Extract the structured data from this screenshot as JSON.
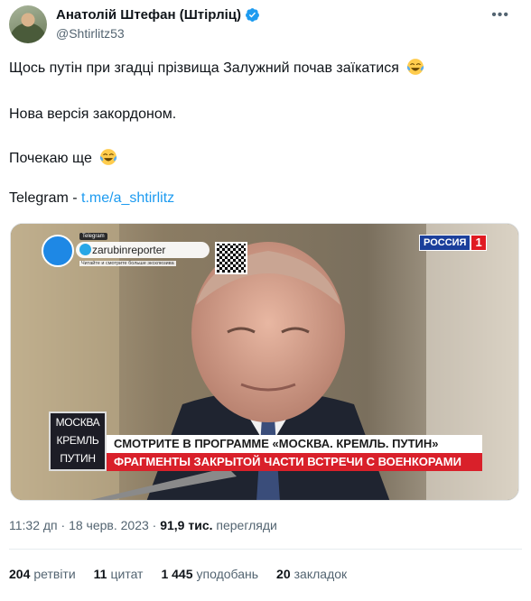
{
  "author": {
    "display_name": "Анатолій Штефан (Штірліц)",
    "handle": "@Shtirlitz53",
    "verified": true
  },
  "tweet": {
    "line1": "Щось путін при згадці прізвища Залужний почав заїкатися",
    "line2": "Нова версія закордоном.",
    "line3": "Почекаю ще",
    "telegram_label": "Telegram - ",
    "telegram_link": "t.me/a_shtirlitz",
    "emoji": "face-with-tears-of-joy"
  },
  "media": {
    "telegram_tag": "Telegram",
    "telegram_handle": "zarubinreporter",
    "telegram_sub": "Читайте и смотрите больше эксклюзива",
    "channel_name": "РОССИЯ",
    "channel_number": "1",
    "show_badge": [
      "МОСКВА",
      "КРЕМЛЬ",
      "ПУТИН"
    ],
    "banner_top": "СМОТРИТЕ В ПРОГРАММЕ «МОСКВА. КРЕМЛЬ. ПУТИН»",
    "banner_bottom": "ФРАГМЕНТЫ ЗАКРЫТОЙ ЧАСТИ ВСТРЕЧИ С ВОЕНКОРАМИ"
  },
  "meta": {
    "time_date": "11:32 дп · 18 черв. 2023 · ",
    "views_count": "91,9 тис.",
    "views_label": " перегляди"
  },
  "stats": {
    "retweets_count": "204",
    "retweets_label": "ретвіти",
    "quotes_count": "11",
    "quotes_label": "цитат",
    "likes_count": "1 445",
    "likes_label": "уподобань",
    "bookmarks_count": "20",
    "bookmarks_label": "закладок"
  },
  "colors": {
    "link": "#1d9bf0",
    "verified": "#1d9bf0",
    "secondary_text": "#536471",
    "banner_red": "#d9202a"
  }
}
